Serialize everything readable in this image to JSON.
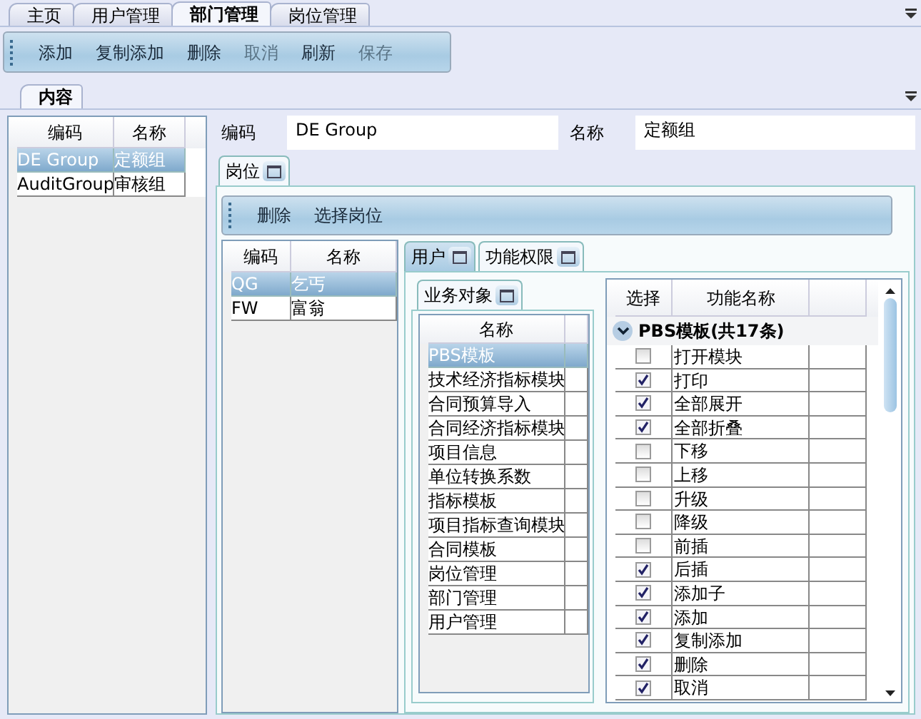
{
  "tabs": [
    {
      "label": "主页",
      "selected": false
    },
    {
      "label": "用户管理",
      "selected": false
    },
    {
      "label": "部门管理",
      "selected": true
    },
    {
      "label": "岗位管理",
      "selected": false
    }
  ],
  "toolbar": [
    {
      "label": "添加",
      "disabled": false
    },
    {
      "label": "复制添加",
      "disabled": false
    },
    {
      "label": "删除",
      "disabled": false
    },
    {
      "label": "取消",
      "disabled": true
    },
    {
      "label": "刷新",
      "disabled": false
    },
    {
      "label": "保存",
      "disabled": true
    }
  ],
  "content_tab": {
    "label": "内容"
  },
  "department_table": {
    "columns": [
      "编码",
      "名称"
    ],
    "rows": [
      {
        "cells": [
          "DE Group",
          "定额组"
        ],
        "selected": true
      },
      {
        "cells": [
          "AuditGroup",
          "审核组"
        ],
        "selected": false
      }
    ]
  },
  "form": {
    "code_label": "编码",
    "code_value": "DE Group",
    "name_label": "名称",
    "name_value": "定额组"
  },
  "position_tab": {
    "label": "岗位"
  },
  "position_toolbar": [
    "删除",
    "选择岗位"
  ],
  "position_table": {
    "columns": [
      "编码",
      "名称"
    ],
    "rows": [
      {
        "cells": [
          "QG",
          "乞丐"
        ],
        "selected": true
      },
      {
        "cells": [
          "FW",
          "富翁"
        ],
        "selected": false
      }
    ]
  },
  "detail_tabs": [
    {
      "label": "用户",
      "selected": false
    },
    {
      "label": "功能权限",
      "selected": true
    }
  ],
  "object_tab": {
    "label": "业务对象"
  },
  "object_table": {
    "columns": [
      "名称"
    ],
    "rows": [
      {
        "name": "PBS模板",
        "selected": true
      },
      {
        "name": "技术经济指标模块",
        "selected": false
      },
      {
        "name": "合同预算导入",
        "selected": false
      },
      {
        "name": "合同经济指标模块",
        "selected": false
      },
      {
        "name": "项目信息",
        "selected": false
      },
      {
        "name": "单位转换系数",
        "selected": false
      },
      {
        "name": "指标模板",
        "selected": false
      },
      {
        "name": "项目指标查询模块",
        "selected": false
      },
      {
        "name": "合同模板",
        "selected": false
      },
      {
        "name": "岗位管理",
        "selected": false
      },
      {
        "name": "部门管理",
        "selected": false
      },
      {
        "name": "用户管理",
        "selected": false
      }
    ]
  },
  "function_table": {
    "columns": [
      "选择",
      "功能名称"
    ],
    "group": {
      "label": "PBS模板(共17条)",
      "expanded": true
    },
    "rows": [
      {
        "name": "打开模块",
        "checked": false
      },
      {
        "name": "打印",
        "checked": true
      },
      {
        "name": "全部展开",
        "checked": true
      },
      {
        "name": "全部折叠",
        "checked": true
      },
      {
        "name": "下移",
        "checked": false
      },
      {
        "name": "上移",
        "checked": false
      },
      {
        "name": "升级",
        "checked": false
      },
      {
        "name": "降级",
        "checked": false
      },
      {
        "name": "前插",
        "checked": false
      },
      {
        "name": "后插",
        "checked": true
      },
      {
        "name": "添加子",
        "checked": true
      },
      {
        "name": "添加",
        "checked": true
      },
      {
        "name": "复制添加",
        "checked": true
      },
      {
        "name": "删除",
        "checked": true
      },
      {
        "name": "取消",
        "checked": true
      }
    ]
  }
}
